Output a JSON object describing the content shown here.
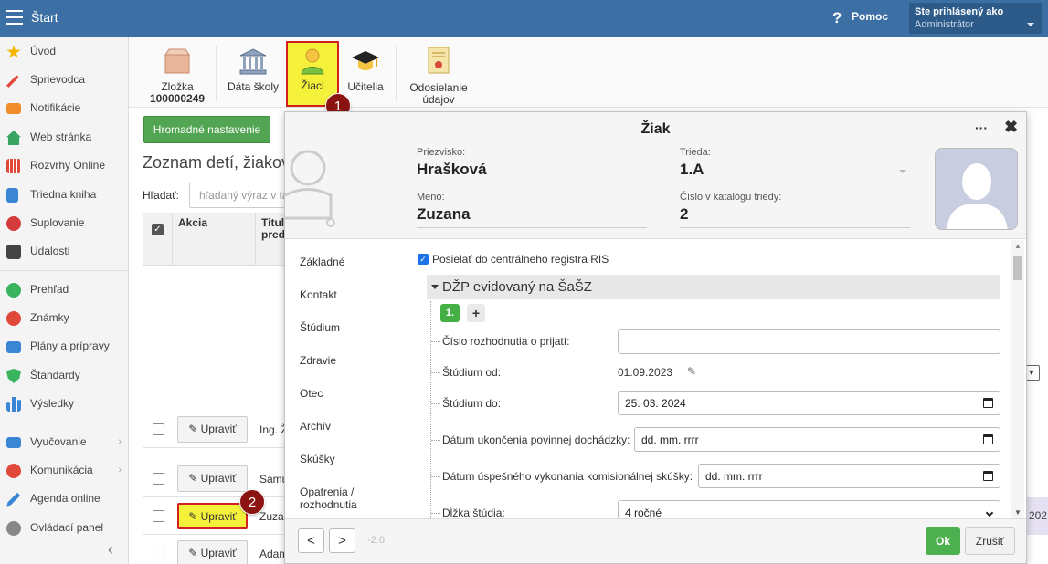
{
  "topbar": {
    "title": "Štart",
    "help_icon": "?",
    "help_label": "Pomoc",
    "user_line1": "Ste prihlásený ako",
    "user_line2": "Administrátor"
  },
  "sidebar": {
    "items": [
      {
        "label": "Úvod",
        "icon": "star-icon",
        "color": "#f4b400"
      },
      {
        "label": "Sprievodca",
        "icon": "wand-icon",
        "color": "#e0493a"
      },
      {
        "label": "Notifikácie",
        "icon": "mail-icon",
        "color": "#f08c2a"
      },
      {
        "label": "Web stránka",
        "icon": "home-icon",
        "color": "#3aa463"
      },
      {
        "label": "Rozvrhy Online",
        "icon": "grid-calendar-icon",
        "color": "#e0493a"
      },
      {
        "label": "Triedna kniha",
        "icon": "book-icon",
        "color": "#3a86d4"
      },
      {
        "label": "Suplovanie",
        "icon": "person-icon",
        "color": "#d63b3b"
      },
      {
        "label": "Udalosti",
        "icon": "calendar-icon",
        "color": "#444444"
      },
      {
        "label": "Prehľad",
        "icon": "check-circle-icon",
        "color": "#3ab45c"
      },
      {
        "label": "Známky",
        "icon": "grades-icon",
        "color": "#e0493a"
      },
      {
        "label": "Plány a prípravy",
        "icon": "briefcase-icon",
        "color": "#3a86d4"
      },
      {
        "label": "Štandardy",
        "icon": "shield-icon",
        "color": "#3ab45c"
      },
      {
        "label": "Výsledky",
        "icon": "bar-chart-icon",
        "color": "#3a86d4"
      },
      {
        "label": "Vyučovanie",
        "icon": "open-book-icon",
        "color": "#3a86d4"
      },
      {
        "label": "Komunikácia",
        "icon": "chat-icon",
        "color": "#e0493a"
      },
      {
        "label": "Agenda online",
        "icon": "pen-icon",
        "color": "#3a86d4"
      },
      {
        "label": "Ovládací panel",
        "icon": "gear-icon",
        "color": "#888888"
      }
    ],
    "collapse": "‹"
  },
  "toolbar": {
    "folder_label": "Zložka",
    "folder_number": "100000249",
    "school_label": "Dáta školy",
    "pupils_label": "Žiaci",
    "teachers_label": "Učitelia",
    "send_label_1": "Odosielanie",
    "send_label_2": "údajov"
  },
  "badges": {
    "one": "1",
    "two": "2"
  },
  "list": {
    "bulk_button": "Hromadné nastavenie",
    "title": "Zoznam detí, žiakov",
    "search_label": "Hľadať:",
    "search_placeholder": "hľadaný výraz v tabuľke",
    "col_action": "Akcia",
    "col_title_1": "Titul",
    "col_title_2": "pred",
    "check_mark": "✓",
    "rows": [
      {
        "edit": "Upraviť",
        "name": "Ing. Ž"
      },
      {
        "edit": "Upraviť",
        "name": "Samu"
      },
      {
        "edit": "Upraviť",
        "name": "Zuza"
      },
      {
        "edit": "Upraviť",
        "name": "Adam"
      }
    ],
    "right_date": "202"
  },
  "modal": {
    "title": "Žiak",
    "more": "···",
    "close": "✖",
    "surname_label": "Priezvisko:",
    "surname": "Hrašková",
    "class_label": "Trieda:",
    "class_value": "1.A",
    "name_label": "Meno:",
    "name": "Zuzana",
    "catalog_label": "Číslo v katalógu triedy:",
    "catalog_value": "2",
    "nav": [
      "Základné",
      "Kontakt",
      "Štúdium",
      "Zdravie",
      "Otec",
      "Archív",
      "Skúšky",
      "Opatrenia /",
      "rozhodnutia"
    ],
    "ris_checkbox": "Posielať do centrálneho registra RIS",
    "section": "DŽP evidovaný na ŠaŠZ",
    "pill": "1.",
    "plus": "+",
    "fields": {
      "decision_label": "Číslo rozhodnutia o prijatí:",
      "decision_value": "",
      "study_from_label": "Štúdium od:",
      "study_from_value": "01.09.2023",
      "study_to_label": "Štúdium do:",
      "study_to_value": "25. 03. 2024",
      "compulsory_end_label": "Dátum ukončenia povinnej dochádzky:",
      "compulsory_end_value": "dd. mm. rrrr",
      "commission_label": "Dátum úspešného vykonania komisionálnej skúšky:",
      "commission_value": "dd. mm. rrrr",
      "length_label": "Dĺžka štúdia:",
      "length_value": "4 ročné"
    },
    "footer": {
      "prev": "<",
      "next": ">",
      "counter": "-2:0",
      "ok": "Ok",
      "cancel": "Zrušiť"
    }
  },
  "colors": {
    "topbar": "#3c70a4",
    "highlight": "#f5f03a",
    "highlight_border": "#d0201f",
    "badge": "#8b1412",
    "ok": "#4caf50"
  }
}
